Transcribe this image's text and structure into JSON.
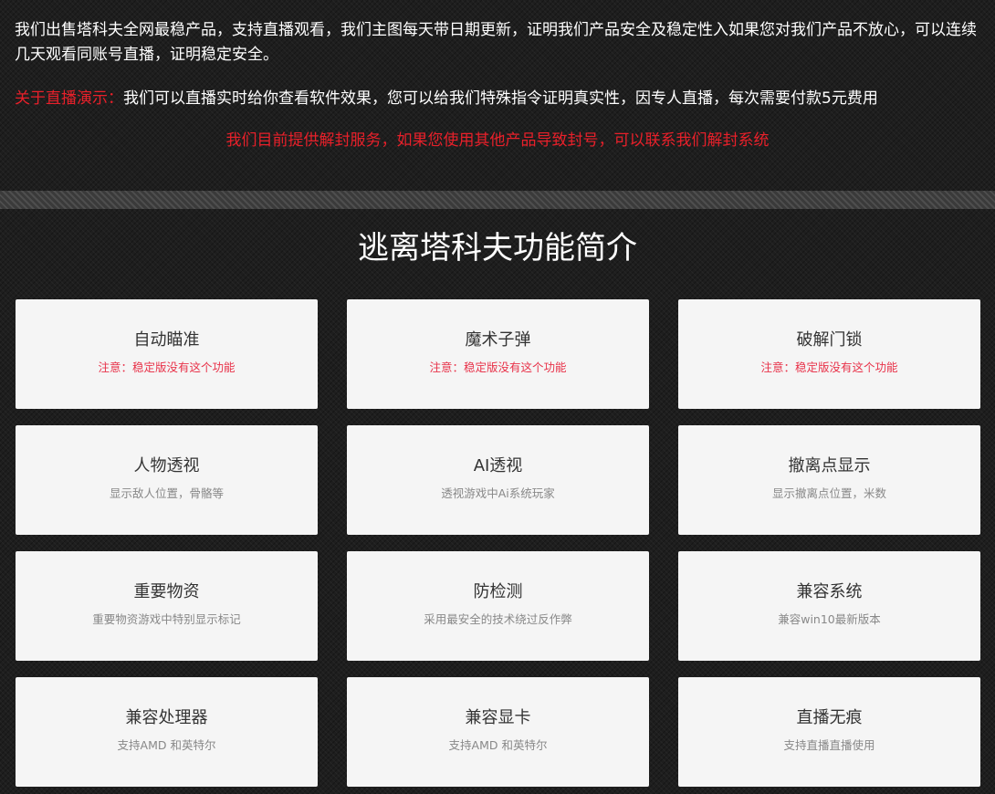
{
  "notice": {
    "main_text": "我们出售塔科夫全网最稳产品，支持直播观看，我们主图每天带日期更新，证明我们产品安全及稳定性入如果您对我们产品不放心，可以连续几天观看同账号直播，证明稳定安全。",
    "live_tag": "关于直播演示：",
    "live_text": "我们可以直播实时给你查看软件效果，您可以给我们特殊指令证明真实性，因专人直播，每次需要付款5元费用",
    "unban_text": "我们目前提供解封服务，如果您使用其他产品导致封号，可以联系我们解封系统"
  },
  "section": {
    "title": "逃离塔科夫功能简介"
  },
  "features": [
    {
      "title": "自动瞄准",
      "desc": "注意：稳定版没有这个功能",
      "warning": true
    },
    {
      "title": "魔术子弹",
      "desc": "注意：稳定版没有这个功能",
      "warning": true
    },
    {
      "title": "破解门锁",
      "desc": "注意：稳定版没有这个功能",
      "warning": true
    },
    {
      "title": "人物透视",
      "desc": "显示敌人位置，骨骼等",
      "warning": false
    },
    {
      "title": "AI透视",
      "desc": "透视游戏中Ai系统玩家",
      "warning": false
    },
    {
      "title": "撤离点显示",
      "desc": "显示撤离点位置，米数",
      "warning": false
    },
    {
      "title": "重要物资",
      "desc": "重要物资游戏中特别显示标记",
      "warning": false
    },
    {
      "title": "防检测",
      "desc": "采用最安全的技术绕过反作弊",
      "warning": false
    },
    {
      "title": "兼容系统",
      "desc": "兼容win10最新版本",
      "warning": false
    },
    {
      "title": "兼容处理器",
      "desc": "支持AMD 和英特尔",
      "warning": false
    },
    {
      "title": "兼容显卡",
      "desc": "支持AMD 和英特尔",
      "warning": false
    },
    {
      "title": "直播无痕",
      "desc": "支持直播直播使用",
      "warning": false
    }
  ],
  "colors": {
    "background": "#1e1e1e",
    "card_background": "#f5f5f5",
    "accent_red": "#e8202a",
    "warning_pink": "#e8334a"
  }
}
